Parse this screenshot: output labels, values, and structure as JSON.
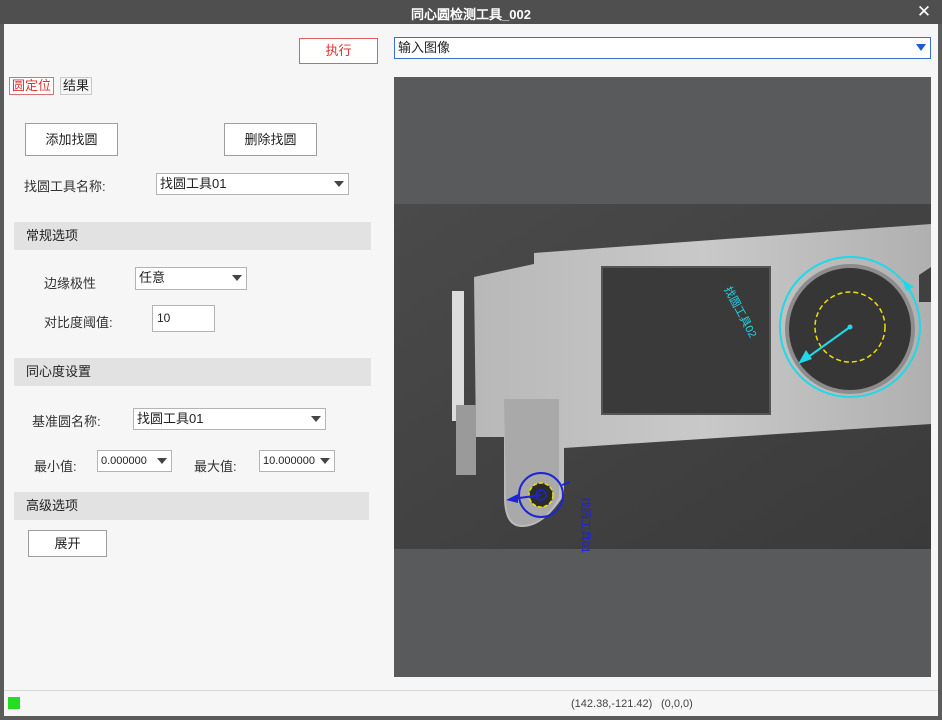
{
  "window": {
    "title": "同心圆检测工具_002",
    "close_glyph": "✕"
  },
  "toolbar": {
    "execute_label": "执行"
  },
  "tabs": [
    {
      "label": "圆定位",
      "active": true
    },
    {
      "label": "结果",
      "active": false
    }
  ],
  "find_circle": {
    "add_label": "添加找圆",
    "delete_label": "删除找圆",
    "tool_name_label": "找圆工具名称:",
    "tool_name_value": "找圆工具01"
  },
  "general_options": {
    "header": "常规选项",
    "edge_polarity_label": "边缘极性",
    "edge_polarity_value": "任意",
    "contrast_label": "对比度阈值:",
    "contrast_value": "10"
  },
  "concentricity": {
    "header": "同心度设置",
    "ref_circle_label": "基准圆名称:",
    "ref_circle_value": "找圆工具01",
    "min_label": "最小值:",
    "min_value": "0.000000",
    "max_label": "最大值:",
    "max_value": "10.000000"
  },
  "advanced": {
    "header": "高级选项",
    "expand_label": "展开"
  },
  "image_source": {
    "value": "输入图像"
  },
  "overlay": {
    "label_large": "找圆工具02",
    "label_small": "找圆工具01",
    "cyan": "#20d8e8",
    "blue": "#1d24d6",
    "yellow": "#f0e000"
  },
  "status": {
    "led_color": "#22dd22",
    "cursor_coord": "(142.38,-121.42)",
    "pixel_value": "(0,0,0)"
  }
}
